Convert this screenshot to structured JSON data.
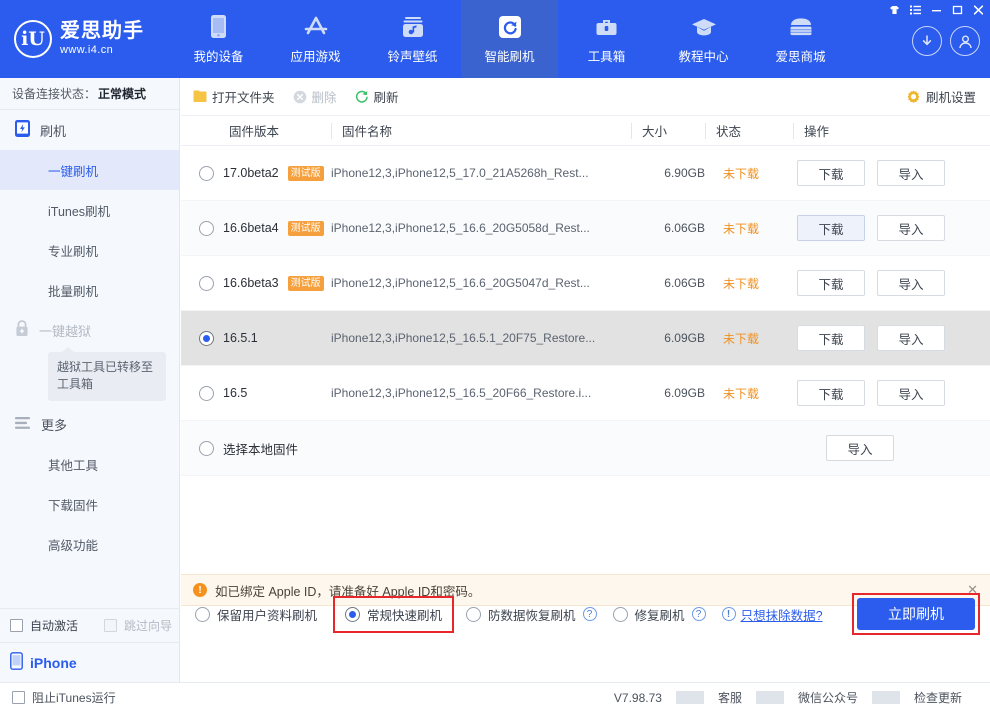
{
  "brand": {
    "name": "爱思助手",
    "url": "www.i4.cn",
    "logo_text": "iU"
  },
  "header": {
    "tabs": [
      {
        "label": "我的设备",
        "icon": "phone-icon",
        "active": false
      },
      {
        "label": "应用游戏",
        "icon": "appstore-icon",
        "active": false
      },
      {
        "label": "铃声壁纸",
        "icon": "music-icon",
        "active": false
      },
      {
        "label": "智能刷机",
        "icon": "refresh-icon",
        "active": true
      },
      {
        "label": "工具箱",
        "icon": "toolbox-icon",
        "active": false
      },
      {
        "label": "教程中心",
        "icon": "graduation-cap-icon",
        "active": false
      },
      {
        "label": "爱思商城",
        "icon": "store-icon",
        "active": false
      }
    ],
    "download_icon": "download-circle-icon",
    "account_icon": "user-circle-icon",
    "window_controls": [
      "skin-icon",
      "menu-list-icon",
      "minimize-icon",
      "maximize-icon",
      "close-icon"
    ],
    "accent_color": "#2b5ced"
  },
  "sidebar": {
    "device_status_label": "设备连接状态：",
    "device_status_value": "正常模式",
    "groups": [
      {
        "title": "刷机",
        "icon": "flash-phone-icon",
        "disabled": false,
        "items": [
          {
            "label": "一键刷机",
            "active": true
          },
          {
            "label": "iTunes刷机",
            "active": false
          },
          {
            "label": "专业刷机",
            "active": false
          },
          {
            "label": "批量刷机",
            "active": false
          }
        ]
      },
      {
        "title": "一键越狱",
        "icon": "lock-icon",
        "disabled": true,
        "tooltip": "越狱工具已转移至工具箱",
        "items": []
      },
      {
        "title": "更多",
        "icon": "more-lines-icon",
        "disabled": false,
        "items": [
          {
            "label": "其他工具",
            "active": false
          },
          {
            "label": "下载固件",
            "active": false
          },
          {
            "label": "高级功能",
            "active": false
          }
        ]
      }
    ],
    "auto_activate_label": "自动激活",
    "auto_activate_checked": false,
    "skip_wizard_label": "跳过向导",
    "skip_wizard_checked": false,
    "skip_wizard_disabled": true,
    "device_name": "iPhone"
  },
  "toolbar": {
    "open_folder_label": "打开文件夹",
    "delete_label": "删除",
    "refresh_label": "刷新",
    "settings_label": "刷机设置"
  },
  "table": {
    "columns": [
      "固件版本",
      "固件名称",
      "大小",
      "状态",
      "操作"
    ],
    "rows": [
      {
        "version": "17.0beta2",
        "badge": "测试版",
        "name": "iPhone12,3,iPhone12,5_17.0_21A5268h_Rest...",
        "size": "6.90GB",
        "state": "未下载",
        "download": "下载",
        "import": "导入",
        "selected": false,
        "download_hover": false
      },
      {
        "version": "16.6beta4",
        "badge": "测试版",
        "name": "iPhone12,3,iPhone12,5_16.6_20G5058d_Rest...",
        "size": "6.06GB",
        "state": "未下载",
        "download": "下载",
        "import": "导入",
        "selected": false,
        "download_hover": true
      },
      {
        "version": "16.6beta3",
        "badge": "测试版",
        "name": "iPhone12,3,iPhone12,5_16.6_20G5047d_Rest...",
        "size": "6.06GB",
        "state": "未下载",
        "download": "下载",
        "import": "导入",
        "selected": false,
        "download_hover": false
      },
      {
        "version": "16.5.1",
        "badge": "",
        "name": "iPhone12,3,iPhone12,5_16.5.1_20F75_Restore...",
        "size": "6.09GB",
        "state": "未下载",
        "download": "下载",
        "import": "导入",
        "selected": true,
        "download_hover": false
      },
      {
        "version": "16.5",
        "badge": "",
        "name": "iPhone12,3,iPhone12,5_16.5_20F66_Restore.i...",
        "size": "6.09GB",
        "state": "未下载",
        "download": "下载",
        "import": "导入",
        "selected": false,
        "download_hover": false
      }
    ],
    "local_row": {
      "label": "选择本地固件",
      "import": "导入"
    }
  },
  "notice": {
    "text": "如已绑定 Apple ID，请准备好 Apple ID和密码。",
    "close": "✕",
    "icon": "warning-icon",
    "bg": "#fdf7ee"
  },
  "actions": {
    "options": [
      {
        "label": "保留用户资料刷机",
        "checked": false,
        "help": false,
        "highlighted": false
      },
      {
        "label": "常规快速刷机",
        "checked": true,
        "help": false,
        "highlighted": true
      },
      {
        "label": "防数据恢复刷机",
        "checked": false,
        "help": true,
        "highlighted": false
      },
      {
        "label": "修复刷机",
        "checked": false,
        "help": true,
        "highlighted": false
      }
    ],
    "erase_link": "只想抹除数据?",
    "flash_button": "立即刷机",
    "highlight_color": "#e8272c",
    "button_color": "#2b5ced"
  },
  "statusbar": {
    "block_itunes_label": "阻止iTunes运行",
    "block_itunes_checked": false,
    "version": "V7.98.73",
    "links": [
      "客服",
      "微信公众号",
      "检查更新"
    ]
  }
}
